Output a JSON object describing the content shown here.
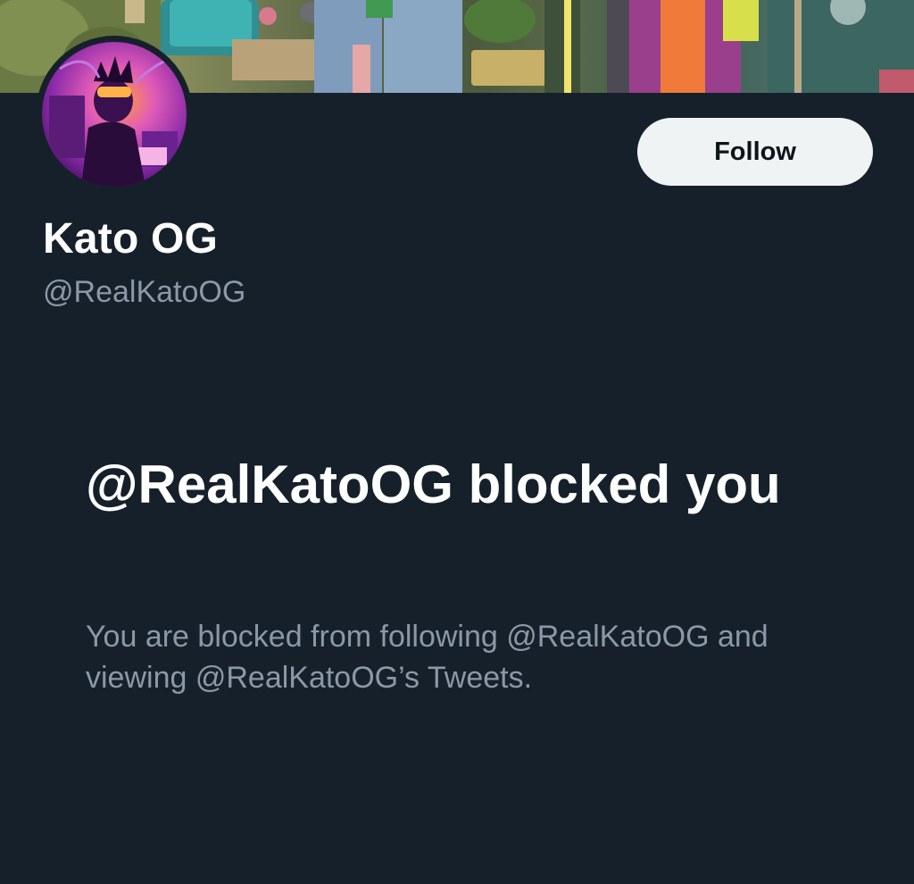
{
  "profile": {
    "display_name": "Kato OG",
    "handle": "@RealKatoOG"
  },
  "actions": {
    "follow_label": "Follow"
  },
  "blocked": {
    "title": "@RealKatoOG blocked you",
    "description": "You are blocked from following @RealKatoOG and viewing @RealKatoOG’s Tweets."
  },
  "colors": {
    "background": "#16202b",
    "primary_text": "#ffffff",
    "secondary_text": "#8b98a5",
    "button_bg": "#eff3f4",
    "button_text": "#0f1419",
    "avatar_accent": "#b14bd6"
  }
}
